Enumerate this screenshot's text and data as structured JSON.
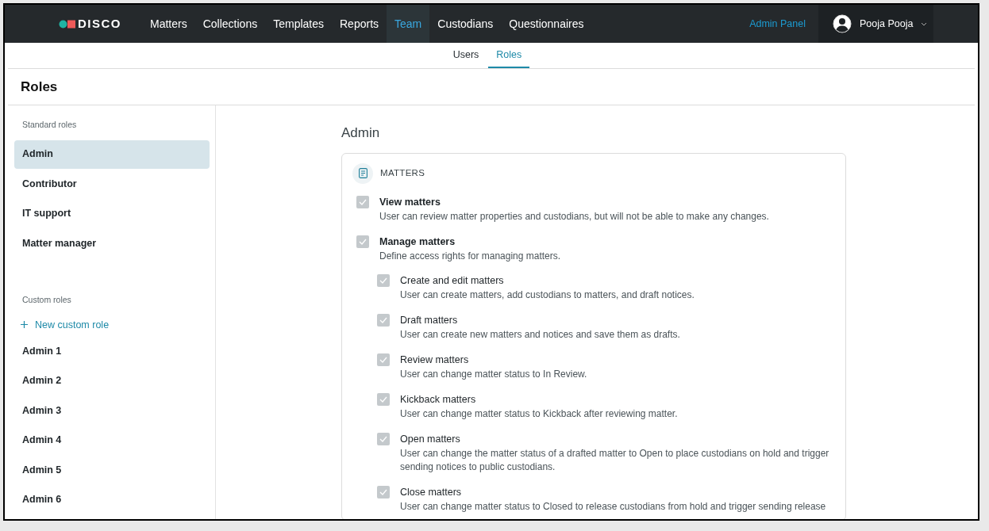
{
  "nav": {
    "logo": "DISCO",
    "items": [
      {
        "label": "Matters",
        "selected": false
      },
      {
        "label": "Collections",
        "selected": false
      },
      {
        "label": "Templates",
        "selected": false
      },
      {
        "label": "Reports",
        "selected": false
      },
      {
        "label": "Team",
        "selected": true
      },
      {
        "label": "Custodians",
        "selected": false
      },
      {
        "label": "Questionnaires",
        "selected": false
      }
    ],
    "admin_link": "Admin Panel",
    "user": "Pooja Pooja"
  },
  "subtabs": [
    {
      "label": "Users",
      "selected": false
    },
    {
      "label": "Roles",
      "selected": true
    }
  ],
  "page_title": "Roles",
  "sidebar": {
    "standard_heading": "Standard roles",
    "standard": [
      {
        "label": "Admin",
        "selected": true
      },
      {
        "label": "Contributor",
        "selected": false
      },
      {
        "label": "IT support",
        "selected": false
      },
      {
        "label": "Matter manager",
        "selected": false
      }
    ],
    "custom_heading": "Custom roles",
    "new_role": "New custom role",
    "custom": [
      {
        "label": "Admin 1",
        "selected": false
      },
      {
        "label": "Admin 2",
        "selected": false
      },
      {
        "label": "Admin 3",
        "selected": false
      },
      {
        "label": "Admin 4",
        "selected": false
      },
      {
        "label": "Admin 5",
        "selected": false
      },
      {
        "label": "Admin 6",
        "selected": false
      }
    ]
  },
  "role_title": "Admin",
  "section": {
    "title": "MATTERS",
    "permissions": [
      {
        "name": "View matters",
        "description": "User can review matter properties and custodians, but will not be able to make any changes.",
        "checked": true
      },
      {
        "name": "Manage matters",
        "description": "Define access rights for managing matters.",
        "checked": true,
        "children": [
          {
            "name": "Create and edit matters",
            "description": "User can create matters, add custodians to matters, and draft notices.",
            "checked": true
          },
          {
            "name": "Draft matters",
            "description": "User can create new matters and notices and save them as drafts.",
            "checked": true
          },
          {
            "name": "Review matters",
            "description": "User can change matter status to In Review.",
            "checked": true
          },
          {
            "name": "Kickback matters",
            "description": "User can change matter status to Kickback after reviewing matter.",
            "checked": true
          },
          {
            "name": "Open matters",
            "description": "User can change the matter status of a drafted matter to Open to place custodians on hold and trigger sending notices to public custodians.",
            "checked": true
          },
          {
            "name": "Close matters",
            "description": "User can change matter status to Closed to release custodians from hold and trigger sending release",
            "checked": true
          }
        ]
      }
    ]
  }
}
